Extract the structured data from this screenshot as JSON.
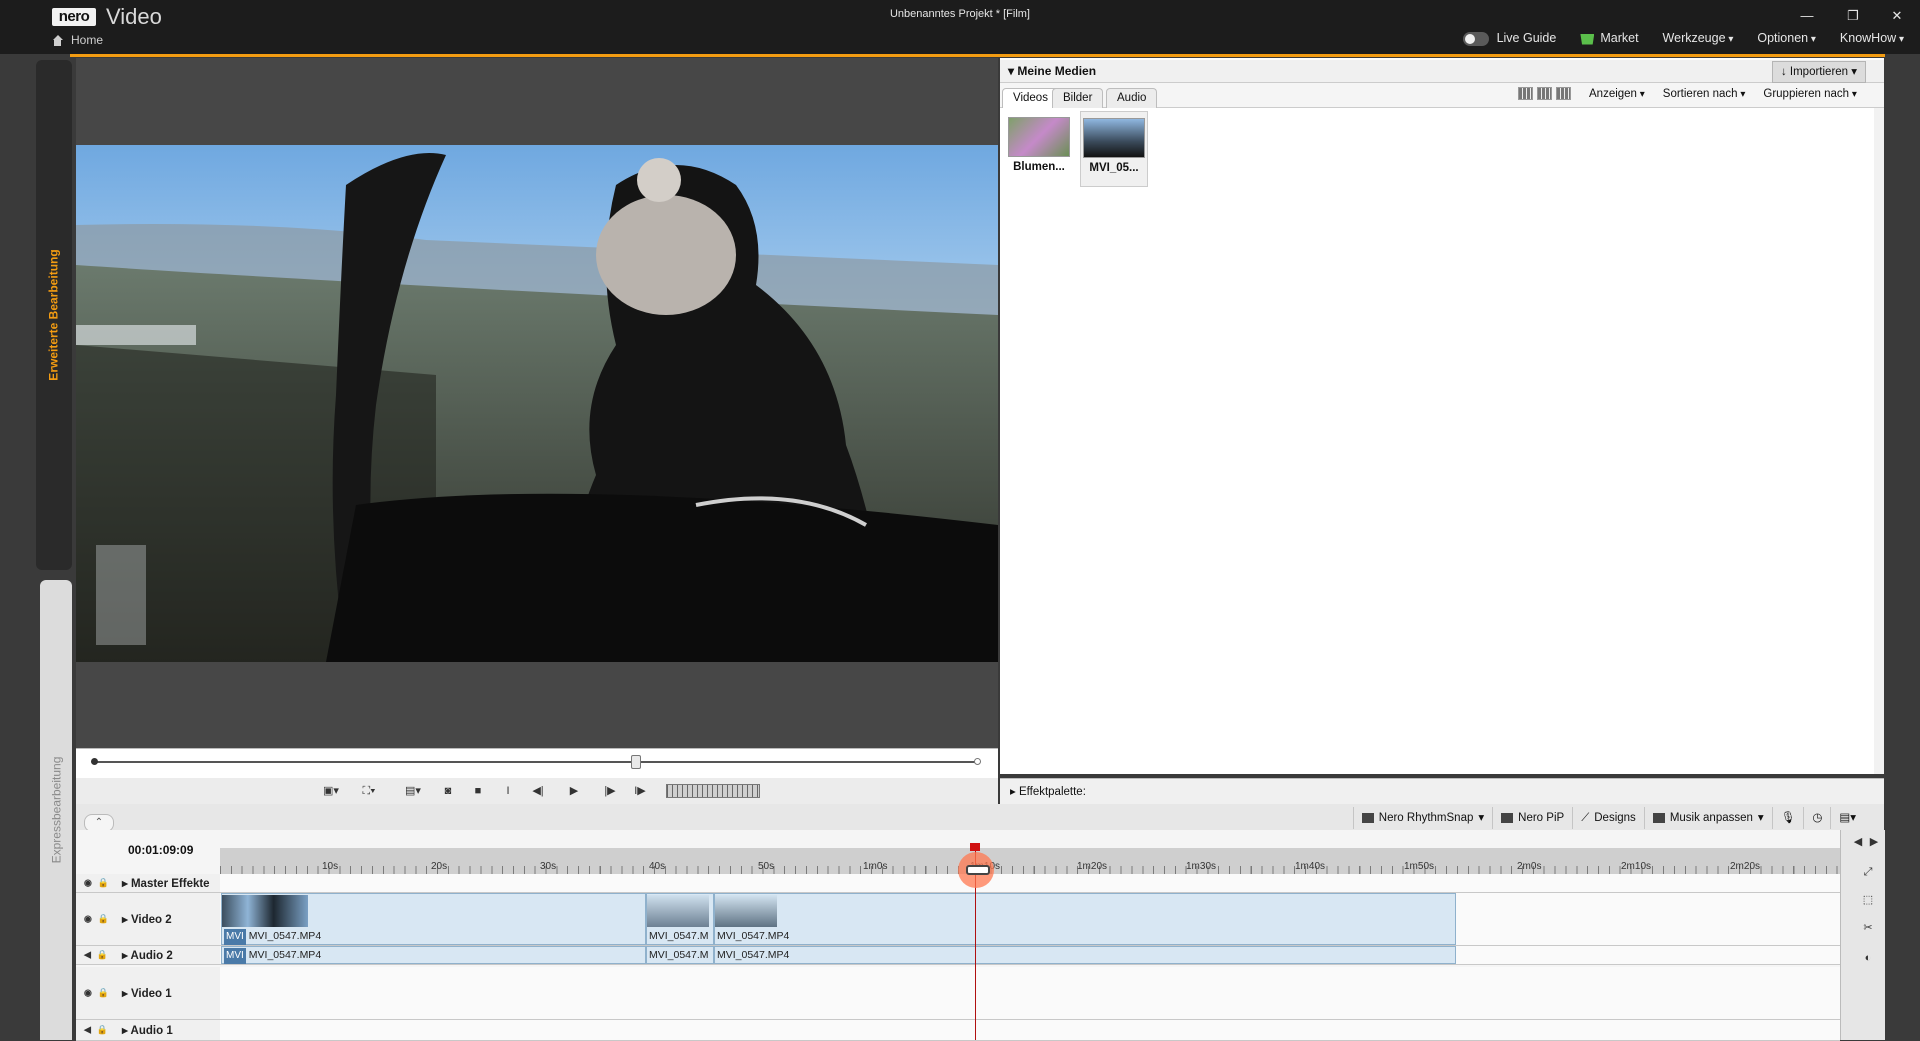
{
  "app": {
    "brand": "nero",
    "name": "Video",
    "home_label": "Home",
    "project_title": "Unbenanntes Projekt * [Film]"
  },
  "window_controls": {
    "minimize": "—",
    "restore": "❐",
    "close": "✕"
  },
  "top_menu": {
    "live_guide": "Live Guide",
    "market": "Market",
    "werkzeuge": "Werkzeuge",
    "optionen": "Optionen",
    "knowhow": "KnowHow"
  },
  "side_rail": {
    "advanced": "Erweiterte Bearbeitung",
    "express": "Expressbearbeitung"
  },
  "media": {
    "title": "Meine Medien",
    "import_label": "Importieren",
    "tabs": [
      "Videos",
      "Bilder",
      "Audio"
    ],
    "tools": {
      "anzeigen": "Anzeigen",
      "sortieren": "Sortieren nach",
      "gruppieren": "Gruppieren nach"
    },
    "items": [
      "Blumen...",
      "MVI_05..."
    ]
  },
  "effects_label": "Effektpalette:",
  "timeline_tools": {
    "rhythmsnap": "Nero RhythmSnap",
    "pip": "Nero PiP",
    "designs": "Designs",
    "musik": "Musik anpassen"
  },
  "timeline": {
    "timecode": "00:01:09:09",
    "ruler_ticks": [
      "10s",
      "20s",
      "30s",
      "40s",
      "50s",
      "1m0s",
      "1m10s",
      "1m20s",
      "1m30s",
      "1m40s",
      "1m50s",
      "2m0s",
      "2m10s",
      "2m20s"
    ],
    "tracks": {
      "master": "Master Effekte",
      "video2": "Video 2",
      "audio2": "Audio 2",
      "video1": "Video 1",
      "audio1": "Audio 1"
    },
    "clips": {
      "tag": "MVI",
      "clip1": "MVI_0547.MP4",
      "clip2": "MVI_0547.M",
      "clip3": "MVI_0547.MP4"
    }
  }
}
